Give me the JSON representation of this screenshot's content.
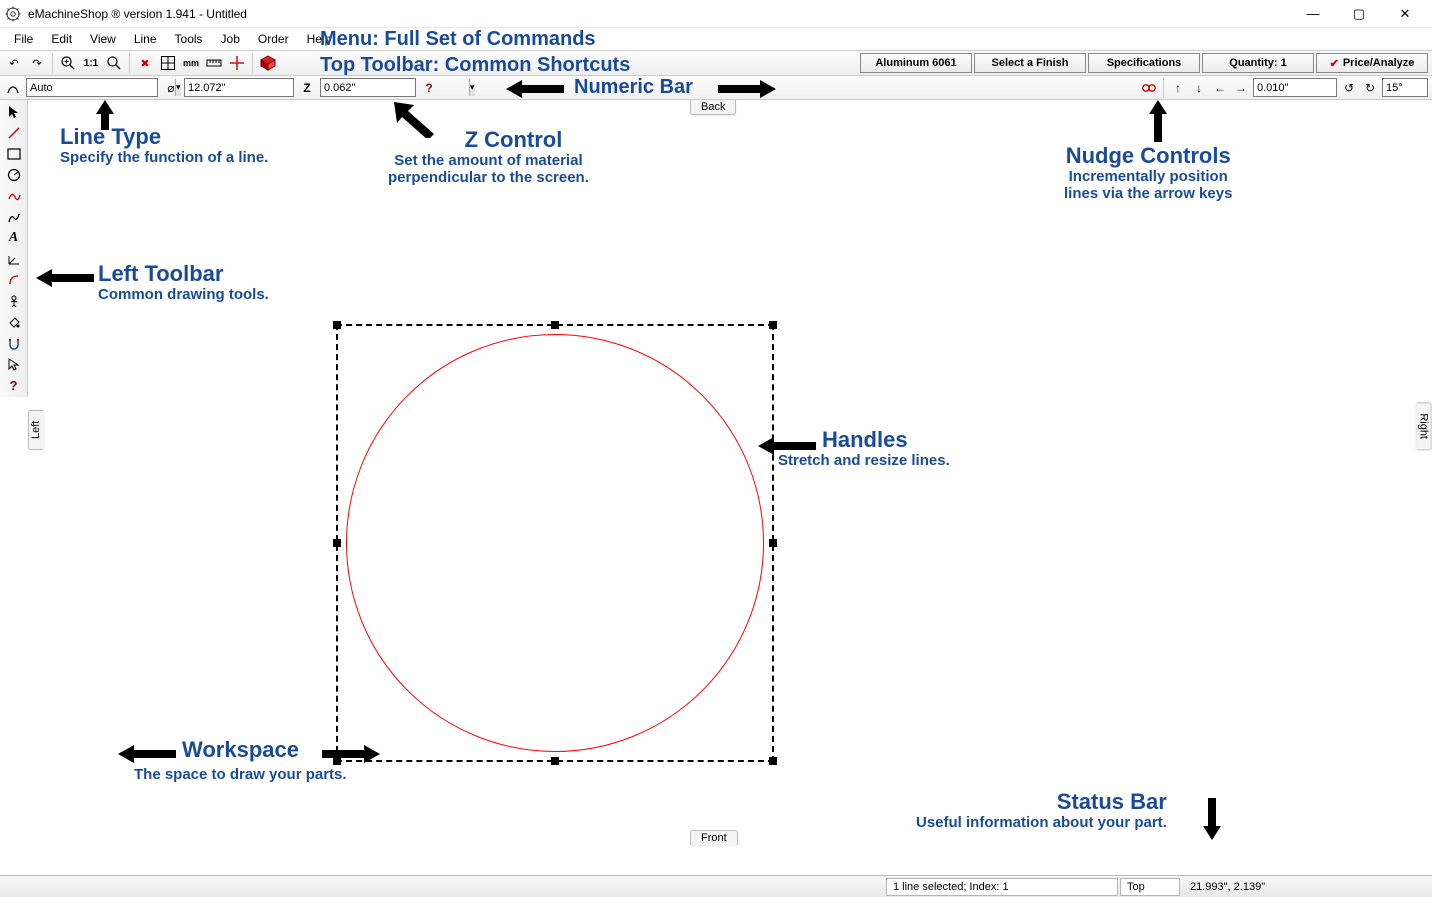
{
  "title": "eMachineShop ®   version 1.941 - Untitled",
  "menu": [
    "File",
    "Edit",
    "View",
    "Line",
    "Tools",
    "Job",
    "Order",
    "Help"
  ],
  "top_buttons": {
    "material": "Aluminum 6061",
    "finish": "Select a Finish",
    "specs": "Specifications",
    "qty": "Quantity: 1",
    "price": "Price/Analyze"
  },
  "numeric": {
    "line_type": "Auto",
    "diameter": "12.072\"",
    "z": "0.062\"",
    "nudge": "0.010\"",
    "rotate": "15°"
  },
  "tabs": {
    "back": "Back",
    "front": "Front",
    "left": "Left",
    "right": "Right"
  },
  "status": {
    "selection": "1 line selected; Index: 1",
    "view": "Top",
    "coords": "21.993\", 2.139\""
  },
  "annotations": {
    "menu_label": "Menu: Full Set of Commands",
    "top_toolbar_label": "Top Toolbar: Common Shortcuts",
    "numeric_bar_label": "Numeric Bar",
    "line_type_title": "Line Type",
    "line_type_sub": "Specify the function of a line.",
    "z_title": "Z Control",
    "z_sub1": "Set the amount of material",
    "z_sub2": "perpendicular to the screen.",
    "left_toolbar_title": "Left Toolbar",
    "left_toolbar_sub": "Common drawing tools.",
    "handles_title": "Handles",
    "handles_sub": "Stretch and resize lines.",
    "workspace_title": "Workspace",
    "workspace_sub": "The space to draw your parts.",
    "nudge_title": "Nudge Controls",
    "nudge_sub1": "Incrementally position",
    "nudge_sub2": "lines via the arrow keys",
    "status_title": "Status Bar",
    "status_sub": "Useful information about your part."
  }
}
